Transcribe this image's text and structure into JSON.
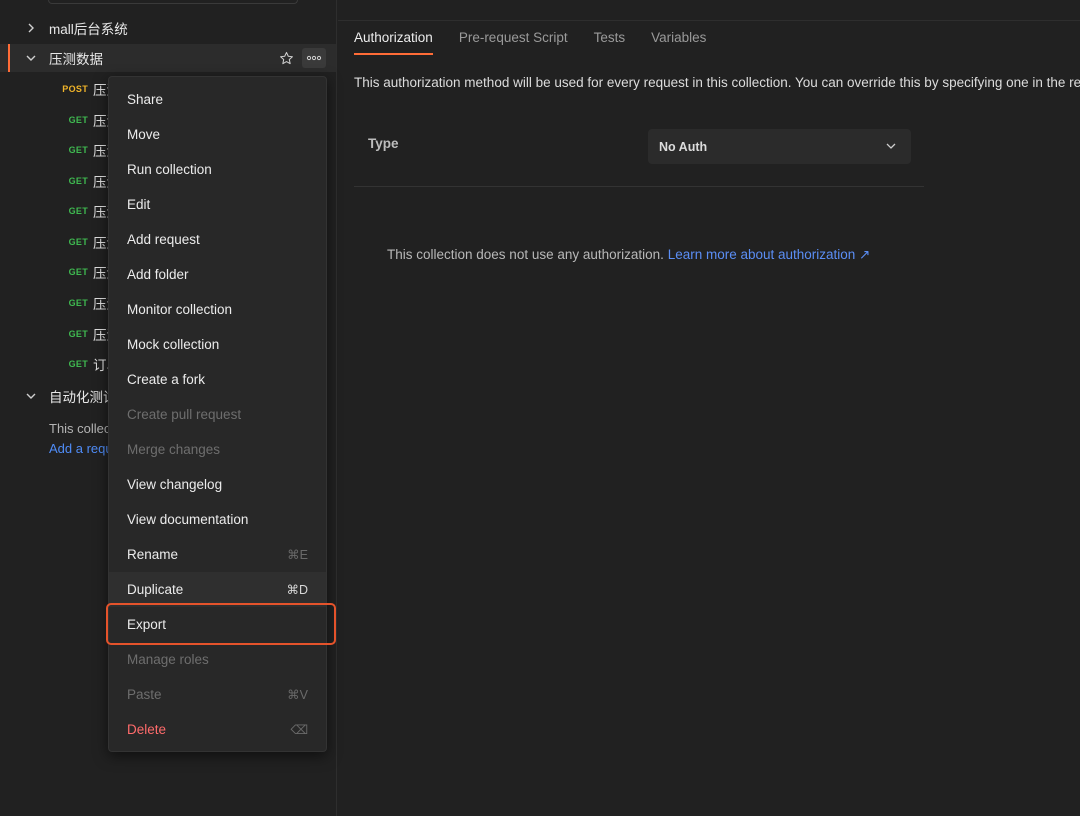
{
  "sidebar": {
    "collections": [
      {
        "name": "mall后台系统",
        "expanded": false
      },
      {
        "name": "压测数据",
        "expanded": true,
        "selected": true
      },
      {
        "name": "自动化测试",
        "expanded": true
      }
    ],
    "requests": [
      {
        "method": "POST",
        "name": "压测"
      },
      {
        "method": "GET",
        "name": "压测"
      },
      {
        "method": "GET",
        "name": "压测"
      },
      {
        "method": "GET",
        "name": "压测"
      },
      {
        "method": "GET",
        "name": "压测"
      },
      {
        "method": "GET",
        "name": "压测"
      },
      {
        "method": "GET",
        "name": "压测"
      },
      {
        "method": "GET",
        "name": "压测"
      },
      {
        "method": "GET",
        "name": "压测"
      },
      {
        "method": "GET",
        "name": "订单"
      }
    ],
    "empty_collection_text": "This collection is empty.",
    "add_request_link": "Add a request"
  },
  "context_menu": {
    "items": [
      {
        "label": "Share",
        "shortcut": "",
        "state": "normal"
      },
      {
        "label": "Move",
        "shortcut": "",
        "state": "normal"
      },
      {
        "label": "Run collection",
        "shortcut": "",
        "state": "normal"
      },
      {
        "label": "Edit",
        "shortcut": "",
        "state": "normal"
      },
      {
        "label": "Add request",
        "shortcut": "",
        "state": "normal"
      },
      {
        "label": "Add folder",
        "shortcut": "",
        "state": "normal"
      },
      {
        "label": "Monitor collection",
        "shortcut": "",
        "state": "normal"
      },
      {
        "label": "Mock collection",
        "shortcut": "",
        "state": "normal"
      },
      {
        "label": "Create a fork",
        "shortcut": "",
        "state": "normal"
      },
      {
        "label": "Create pull request",
        "shortcut": "",
        "state": "disabled"
      },
      {
        "label": "Merge changes",
        "shortcut": "",
        "state": "disabled"
      },
      {
        "label": "View changelog",
        "shortcut": "",
        "state": "normal"
      },
      {
        "label": "View documentation",
        "shortcut": "",
        "state": "normal"
      },
      {
        "label": "Rename",
        "shortcut": "⌘E",
        "state": "normal"
      },
      {
        "label": "Duplicate",
        "shortcut": "⌘D",
        "state": "hover"
      },
      {
        "label": "Export",
        "shortcut": "",
        "state": "highlighted"
      },
      {
        "label": "Manage roles",
        "shortcut": "",
        "state": "disabled"
      },
      {
        "label": "Paste",
        "shortcut": "⌘V",
        "state": "disabled"
      },
      {
        "label": "Delete",
        "shortcut": "⌫",
        "state": "danger"
      }
    ]
  },
  "main": {
    "tabs": [
      {
        "label": "Authorization",
        "active": true
      },
      {
        "label": "Pre-request Script",
        "active": false
      },
      {
        "label": "Tests",
        "active": false
      },
      {
        "label": "Variables",
        "active": false
      }
    ],
    "description": "This authorization method will be used for every request in this collection. You can override this by specifying one in the request.",
    "type_label": "Type",
    "type_value": "No Auth",
    "no_auth_text": "This collection does not use any authorization.",
    "learn_more_link": "Learn more about authorization ↗"
  },
  "colors": {
    "accent": "#ff6c37",
    "post_method": "#f0b429",
    "get_method": "#3fb950",
    "link": "#4f8cf7",
    "danger": "#ff6b6b",
    "highlight_box": "#e5532b"
  }
}
